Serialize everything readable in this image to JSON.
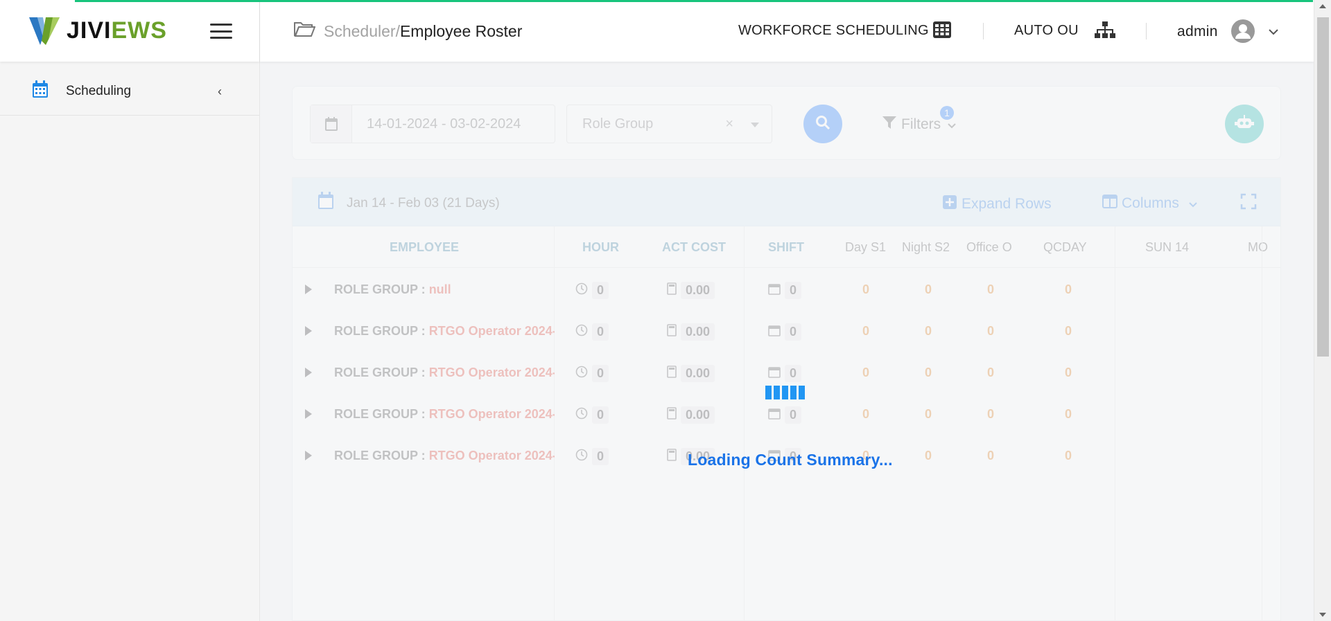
{
  "app": {
    "logo_text_black": "JIVI",
    "logo_text_green": "EWS"
  },
  "sidebar": {
    "items": [
      {
        "label": "Scheduling",
        "icon": "calendar-icon"
      }
    ]
  },
  "header": {
    "breadcrumb_parent": "Scheduler/",
    "breadcrumb_current": "Employee Roster",
    "module_label": "WORKFORCE SCHEDULING",
    "ou_label": "AUTO OU",
    "user_label": "admin"
  },
  "filters": {
    "date_range": "14-01-2024 - 03-02-2024",
    "role_group_placeholder": "Role Group",
    "clear_symbol": "×",
    "filters_label": "Filters",
    "filters_count": "1"
  },
  "grid": {
    "range_label": "Jan 14 - Feb 03 (21 Days)",
    "expand_label": "Expand Rows",
    "columns_label": "Columns",
    "headers": {
      "employee": "EMPLOYEE",
      "hour": "HOUR",
      "act_cost": "ACT COST",
      "shift": "SHIFT",
      "day_s1": "Day S1",
      "night_s2": "Night S2",
      "office_o": "Office O",
      "qcday": "QCDAY",
      "sun14": "SUN 14",
      "mon": "MO"
    },
    "rows": [
      {
        "prefix": "ROLE GROUP : ",
        "value": "null",
        "hour": "0",
        "cost": "0.00",
        "shift": "0",
        "day_s1": "0",
        "night_s2": "0",
        "office_o": "0",
        "qcday": "0"
      },
      {
        "prefix": "ROLE GROUP : ",
        "value": "RTGO Operator 2024-",
        "hour": "0",
        "cost": "0.00",
        "shift": "0",
        "day_s1": "0",
        "night_s2": "0",
        "office_o": "0",
        "qcday": "0"
      },
      {
        "prefix": "ROLE GROUP : ",
        "value": "RTGO Operator 2024-",
        "hour": "0",
        "cost": "0.00",
        "shift": "0",
        "day_s1": "0",
        "night_s2": "0",
        "office_o": "0",
        "qcday": "0"
      },
      {
        "prefix": "ROLE GROUP : ",
        "value": "RTGO Operator 2024-",
        "hour": "0",
        "cost": "0.00",
        "shift": "0",
        "day_s1": "0",
        "night_s2": "0",
        "office_o": "0",
        "qcday": "0"
      },
      {
        "prefix": "ROLE GROUP : ",
        "value": "RTGO Operator 2024-",
        "hour": "0",
        "cost": "0.00",
        "shift": "0",
        "day_s1": "0",
        "night_s2": "0",
        "office_o": "0",
        "qcday": "0"
      }
    ]
  },
  "loading": {
    "text": "Loading Count Summary..."
  },
  "colors": {
    "accent": "#1a73e8",
    "progress": "#18c47d",
    "logo_green": "#6aa02a"
  }
}
